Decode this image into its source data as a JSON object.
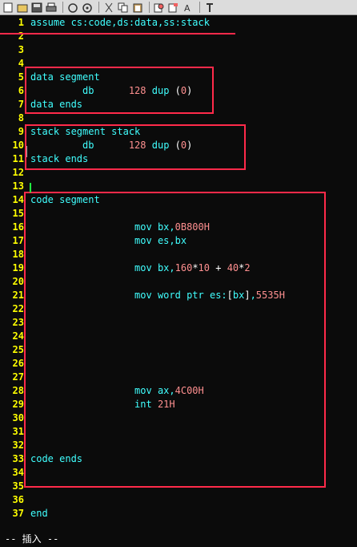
{
  "toolbar": {
    "icons": [
      "new-icon",
      "open-icon",
      "save-icon",
      "print-icon",
      "undo-icon",
      "redo-icon",
      "cut-icon",
      "copy-icon",
      "paste-icon",
      "find-icon",
      "replace-icon",
      "tool-icon"
    ]
  },
  "editor": {
    "lines": [
      {
        "n": "1",
        "t": "assume cs:code,ds:data,ss:stack"
      },
      {
        "n": "2",
        "t": ""
      },
      {
        "n": "3",
        "t": ""
      },
      {
        "n": "4",
        "t": ""
      },
      {
        "n": "5",
        "t": "data segment"
      },
      {
        "n": "6",
        "t": "         db      128 dup (0)"
      },
      {
        "n": "7",
        "t": "data ends"
      },
      {
        "n": "8",
        "t": ""
      },
      {
        "n": "9",
        "t": "stack segment stack"
      },
      {
        "n": "10",
        "t": "         db      128 dup (0)"
      },
      {
        "n": "11",
        "t": "stack ends"
      },
      {
        "n": "12",
        "t": ""
      },
      {
        "n": "13",
        "t": ""
      },
      {
        "n": "14",
        "t": "code segment"
      },
      {
        "n": "15",
        "t": ""
      },
      {
        "n": "16",
        "t": "                  mov bx,0B800H"
      },
      {
        "n": "17",
        "t": "                  mov es,bx"
      },
      {
        "n": "18",
        "t": ""
      },
      {
        "n": "19",
        "t": "                  mov bx,160*10 + 40*2"
      },
      {
        "n": "20",
        "t": ""
      },
      {
        "n": "21",
        "t": "                  mov word ptr es:[bx],5535H"
      },
      {
        "n": "22",
        "t": ""
      },
      {
        "n": "23",
        "t": ""
      },
      {
        "n": "24",
        "t": ""
      },
      {
        "n": "25",
        "t": ""
      },
      {
        "n": "26",
        "t": ""
      },
      {
        "n": "27",
        "t": ""
      },
      {
        "n": "28",
        "t": "                  mov ax,4C00H"
      },
      {
        "n": "29",
        "t": "                  int 21H"
      },
      {
        "n": "30",
        "t": ""
      },
      {
        "n": "31",
        "t": ""
      },
      {
        "n": "32",
        "t": ""
      },
      {
        "n": "33",
        "t": "code ends"
      },
      {
        "n": "34",
        "t": ""
      },
      {
        "n": "35",
        "t": ""
      },
      {
        "n": "36",
        "t": ""
      },
      {
        "n": "37",
        "t": "end"
      }
    ]
  },
  "status": {
    "mode": "-- 插入 --"
  },
  "colors": {
    "background": "#0b0b0b",
    "line_number": "#ffff00",
    "code_text": "#40ffff",
    "number_literal": "#ff9090",
    "highlight_box": "#ff2a4a"
  }
}
